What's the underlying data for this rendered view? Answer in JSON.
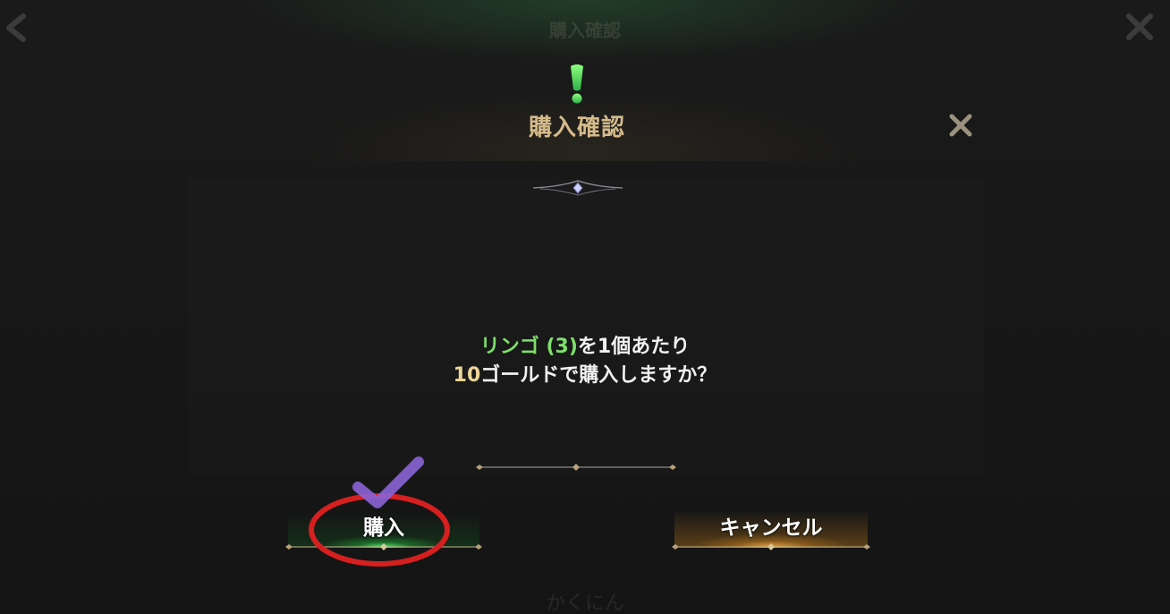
{
  "background": {
    "title": "購入確認",
    "footer_text": "かくにん"
  },
  "modal": {
    "title": "購入確認",
    "message": {
      "item_name": "リンゴ",
      "item_count": "(3)",
      "line1_suffix": "を1個あたり",
      "price": "10",
      "line2_suffix": "ゴールドで購入しますか？"
    },
    "buttons": {
      "buy": "購入",
      "cancel": "キャンセル"
    }
  },
  "colors": {
    "title": "#d5bb8a",
    "item_highlight": "#7ee06a",
    "price_highlight": "#ecd598",
    "buy_glow": "#5aff78",
    "cancel_glow": "#ffbe50",
    "annotation_circle": "#d61f1f",
    "annotation_check": "#8a64d6"
  },
  "icons": {
    "alert": "exclamation-icon",
    "close": "close-icon",
    "back": "back-arrow-icon"
  }
}
